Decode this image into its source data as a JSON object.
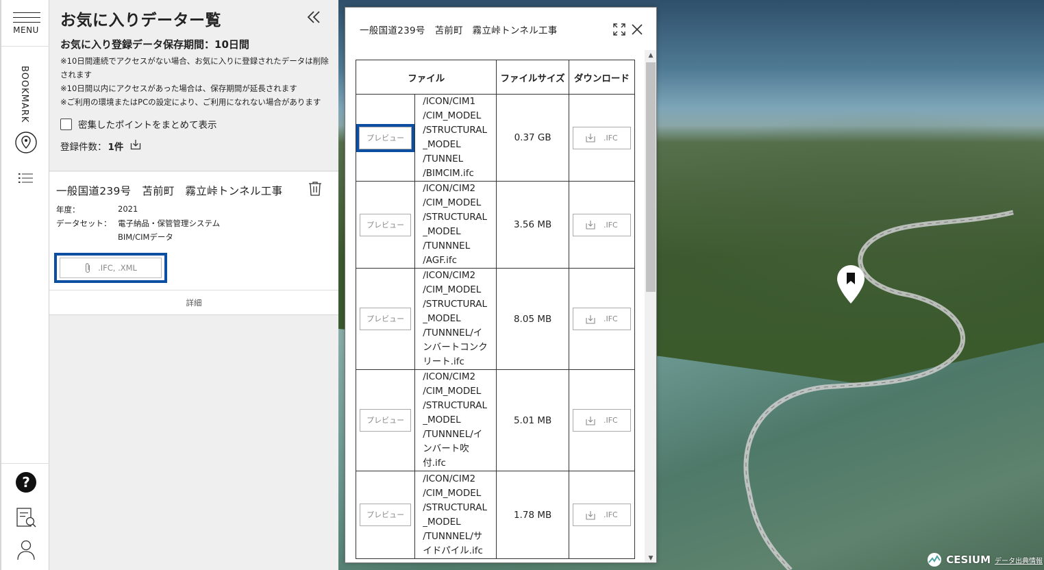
{
  "rail": {
    "menu_label": "MENU",
    "bookmark_label": "BOOKMARK"
  },
  "panel": {
    "title": "お気に入りデーター覧",
    "retention": "お気に入り登録データ保存期間：10日間",
    "notes": [
      "※10日間連続でアクセスがない場合、お気に入りに登録されたデータは削除されます",
      "※10日間以内にアクセスがあった場合は、保存期間が延長されます",
      "※ご利用の環境またはPCの設定により、ご利用になれない場合があります"
    ],
    "cluster_label": "密集したポイントをまとめて表示",
    "count_label": "登録件数：",
    "count_value": "1件"
  },
  "favorite": {
    "title": "一般国道239号　苫前町　霧立峠トンネル工事",
    "year_key": "年度：",
    "year_value": "2021",
    "dataset_key": "データセット：",
    "dataset_value_1": "電子納品・保管管理システム",
    "dataset_value_2": "BIM/CIMデータ",
    "attach_label": ".IFC, .XML",
    "detail_label": "詳細"
  },
  "dialog": {
    "title": "一般国道239号　苫前町　霧立峠トンネル工事",
    "headers": {
      "file": "ファイル",
      "size": "ファイルサイズ",
      "download": "ダウンロード"
    },
    "preview_label": "プレビュー",
    "download_label": ".IFC",
    "rows": [
      {
        "path": "/ICON/CIM1\n/CIM_MODEL\n/STRUCTURAL\n_MODEL\n/TUNNEL\n/BIMCIM.ifc",
        "size": "0.37 GB"
      },
      {
        "path": "/ICON/CIM2\n/CIM_MODEL\n/STRUCTURAL\n_MODEL\n/TUNNNEL\n/AGF.ifc",
        "size": "3.56 MB"
      },
      {
        "path": "/ICON/CIM2\n/CIM_MODEL\n/STRUCTURAL\n_MODEL\n/TUNNNEL/イ\nンバートコンク\nリート.ifc",
        "size": "8.05 MB"
      },
      {
        "path": "/ICON/CIM2\n/CIM_MODEL\n/STRUCTURAL\n_MODEL\n/TUNNNEL/イ\nンバート吹\n付.ifc",
        "size": "5.01 MB"
      },
      {
        "path": "/ICON/CIM2\n/CIM_MODEL\n/STRUCTURAL\n_MODEL\n/TUNNNEL/サ\nイドパイル.ifc",
        "size": "1.78 MB"
      }
    ]
  },
  "map": {
    "credit": "CESIUM",
    "data_source": "データ出典情報"
  }
}
